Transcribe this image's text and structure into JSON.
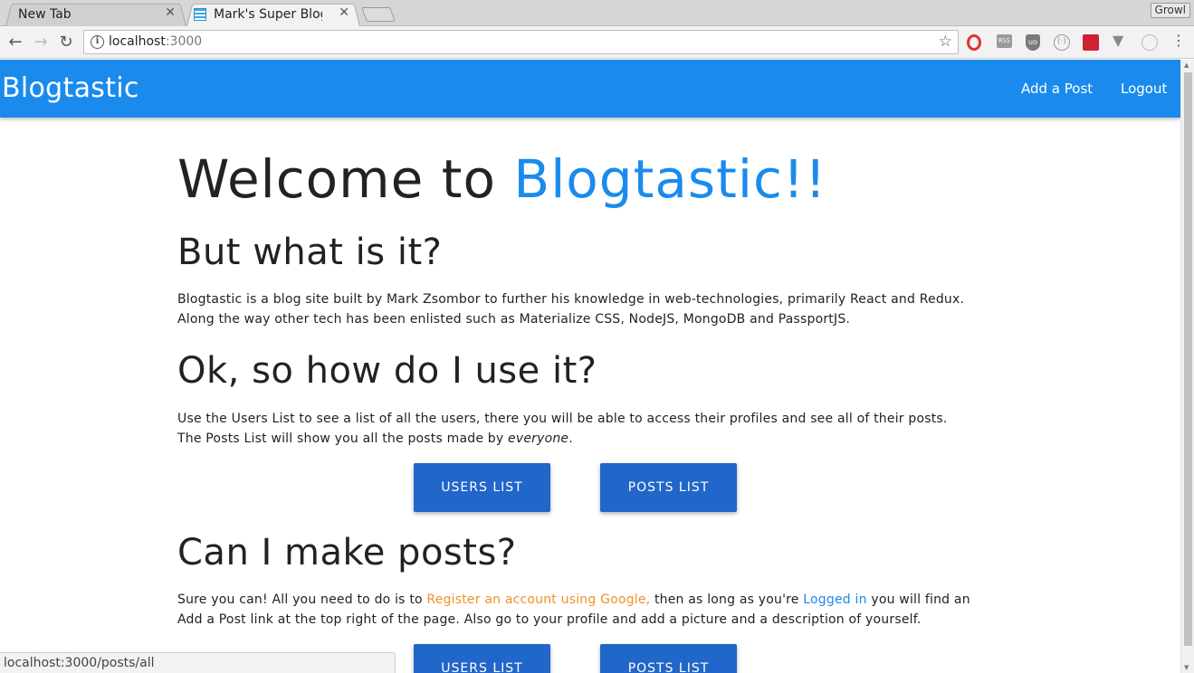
{
  "browser": {
    "tabs": [
      {
        "label": "New Tab",
        "active": false
      },
      {
        "label": "Mark's Super Blog S",
        "active": true
      }
    ],
    "growl_label": "Growl",
    "url_host": "localhost",
    "url_port": ":3000",
    "status_url": "localhost:3000/posts/all"
  },
  "navbar": {
    "brand": "Blogtastic",
    "links": [
      "Add a Post",
      "Logout"
    ],
    "color": "#1a8bed"
  },
  "main": {
    "welcome_prefix": "Welcome to ",
    "welcome_accent": "Blogtastic!!",
    "section1_title": "But what is it?",
    "section1_line1": "Blogtastic is a blog site built by Mark Zsombor to further his knowledge in web-technologies, primarily React and Redux.",
    "section1_line2": "Along the way other tech has been enlisted such as Materialize CSS, NodeJS, MongoDB and PassportJS.",
    "section2_title": "Ok, so how do I use it?",
    "section2_line1": "Use the Users List to see a list of all the users, there you will be able to access their profiles and see all of their posts.",
    "section2_line2_prefix": "The Posts List will show you all the posts made by ",
    "section2_line2_em": "everyone",
    "section2_line2_suffix": ".",
    "buttons": [
      "USERS LIST",
      "POSTS LIST"
    ],
    "section3_title": "Can I make posts?",
    "section3_line1_a": "Sure you can! All you need to do is to ",
    "section3_link_register": "Register an account using Google,",
    "section3_line1_b": " then as long as you're ",
    "section3_link_login": "Logged in",
    "section3_line1_c": " you will find an",
    "section3_line2": "Add a Post link at the top right of the page. Also go to your profile and add a picture and a description of yourself.",
    "button_color": "#2166c9",
    "register_color": "#f0902b"
  }
}
